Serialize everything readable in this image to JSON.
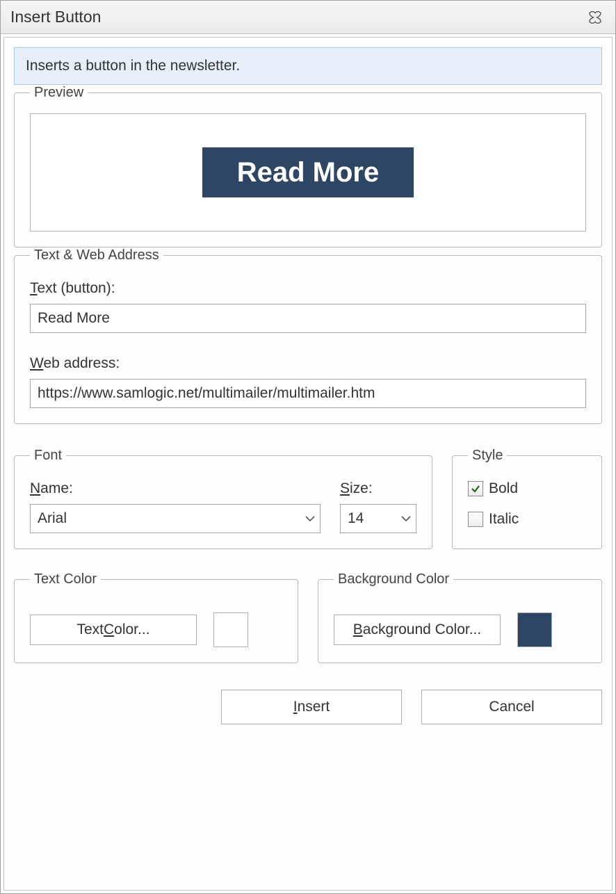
{
  "title": "Insert Button",
  "description": "Inserts a button in the newsletter.",
  "groups": {
    "preview": "Preview",
    "text_web": "Text & Web Address",
    "font": "Font",
    "style": "Style",
    "text_color": "Text Color",
    "bg_color": "Background Color"
  },
  "preview_button_text": "Read More",
  "labels": {
    "text_button": "ext (button):",
    "text_button_mn": "T",
    "web_address": "eb address:",
    "web_address_mn": "W",
    "font_name": "ame:",
    "font_name_mn": "N",
    "font_size": "ize:",
    "font_size_mn": "S",
    "bold": "Bold",
    "italic": "Italic",
    "text_color_btn": "olor...",
    "text_color_btn_pre": "Text ",
    "text_color_btn_mn": "C",
    "bg_color_btn": "ackground Color...",
    "bg_color_btn_mn": "B",
    "insert": "nsert",
    "insert_mn": "I",
    "cancel": "Cancel"
  },
  "values": {
    "text": "Read More",
    "web": "https://www.samlogic.net/multimailer/multimailer.htm",
    "font_name": "Arial",
    "font_size": "14",
    "bold": true,
    "italic": false,
    "text_color": "#ffffff",
    "bg_color": "#2e4663"
  }
}
